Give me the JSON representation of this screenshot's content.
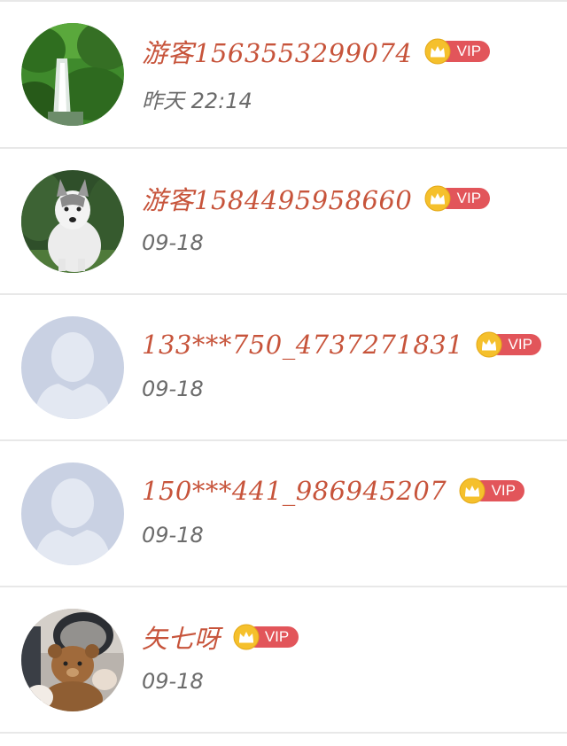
{
  "rows": [
    {
      "name": "游客1563553299074",
      "badge": "VIP",
      "time": "昨天 22:14",
      "avatar": "waterfall-photo-avatar"
    },
    {
      "name": "游客1584495958660",
      "badge": "VIP",
      "time": "09-18",
      "avatar": "husky-photo-avatar"
    },
    {
      "name": "133***750_4737271831",
      "badge": "VIP",
      "time": "09-18",
      "avatar": "default-person-avatar"
    },
    {
      "name": "150***441_986945207",
      "badge": "VIP",
      "time": "09-18",
      "avatar": "default-person-avatar"
    },
    {
      "name": "矢七呀",
      "badge": "VIP",
      "time": "09-18",
      "avatar": "teddy-bear-photo-avatar"
    }
  ],
  "colors": {
    "name_text": "#c7543b",
    "vip_pill": "#e2555a",
    "vip_coin": "#f5c02c",
    "time_text": "#6b6b6b",
    "divider": "#e8e8e8",
    "default_avatar_bg": "#c9d1e3"
  }
}
